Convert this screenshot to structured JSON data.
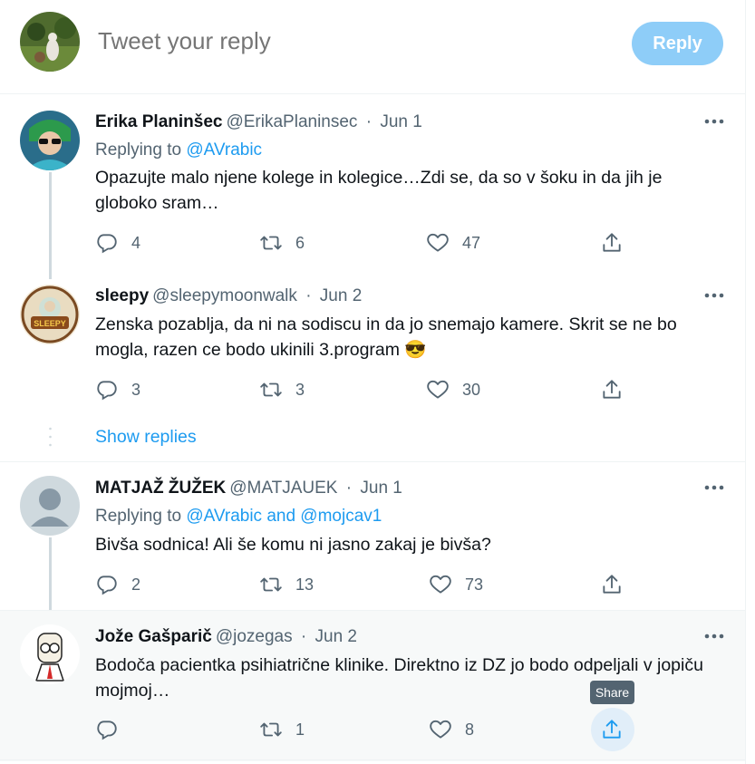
{
  "compose": {
    "placeholder": "Tweet your reply",
    "reply_label": "Reply"
  },
  "tweets": [
    {
      "name": "Erika Planinšec",
      "handle": "@ErikaPlaninsec",
      "sep": "·",
      "date": "Jun 1",
      "replying_prefix": "Replying to",
      "replying_to": "@AVrabic",
      "text": "Opazujte malo njene kolege in kolegice…Zdi se, da so v šoku in da jih je globoko sram…",
      "replies": "4",
      "retweets": "6",
      "likes": "47"
    },
    {
      "name": "sleepy",
      "handle": "@sleepymoonwalk",
      "sep": "·",
      "date": "Jun 2",
      "text": "Zenska pozablja, da ni na sodiscu in da jo snemajo kamere. Skrit se ne bo mogla, razen ce bodo ukinili 3.program 😎",
      "avatar_badge": "SLEEPY",
      "replies": "3",
      "retweets": "3",
      "likes": "30"
    },
    {
      "name": "MATJAŽ ŽUŽEK",
      "handle": "@MATJAUEK",
      "sep": "·",
      "date": "Jun 1",
      "replying_prefix": "Replying to",
      "replying_to": "@AVrabic and @mojcav1",
      "text": "Bivša sodnica! Ali še komu ni jasno zakaj je bivša?",
      "replies": "2",
      "retweets": "13",
      "likes": "73"
    },
    {
      "name": "Jože Gašparič",
      "handle": "@jozegas",
      "sep": "·",
      "date": "Jun 2",
      "text": "Bodoča pacientka psihiatrične klinike. Direktno iz DZ jo bodo odpeljali v jopiču mojmoj…",
      "replies": "",
      "retweets": "1",
      "likes": "8"
    }
  ],
  "show_replies": "Show replies",
  "tooltip": "Share",
  "icons": {
    "reply": "reply-icon",
    "retweet": "retweet-icon",
    "like": "heart-icon",
    "share": "share-icon",
    "more": "more-icon"
  },
  "colors": {
    "accent": "#1d9bf0",
    "muted": "#536471",
    "reply_button": "#8ecdf8"
  }
}
